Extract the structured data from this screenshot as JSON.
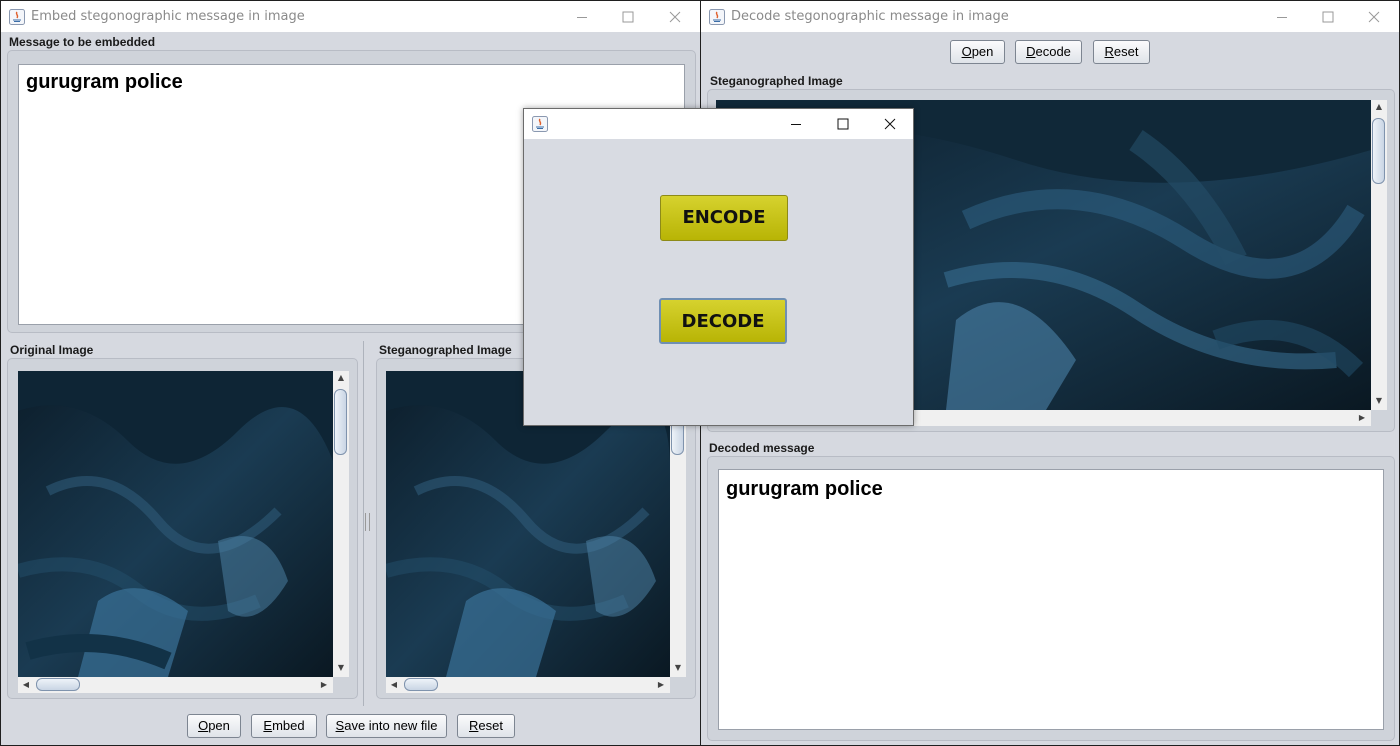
{
  "embed_window": {
    "title": "Embed stegonographic message in image",
    "message_label": "Message to be embedded",
    "message_text": "gurugram police",
    "original_label": "Original Image",
    "stego_label": "Steganographed Image",
    "buttons": {
      "open_first": "O",
      "open_rest": "pen",
      "embed_first": "E",
      "embed_rest": "mbed",
      "save_first": "S",
      "save_rest": "ave into new file",
      "reset_first": "R",
      "reset_rest": "eset"
    }
  },
  "decode_window": {
    "title": "Decode stegonographic message in image",
    "buttons": {
      "open_first": "O",
      "open_rest": "pen",
      "decode_first": "D",
      "decode_rest": "ecode",
      "reset_first": "R",
      "reset_rest": "eset"
    },
    "stego_label": "Steganographed Image",
    "decoded_label": "Decoded message",
    "decoded_text": "gurugram police"
  },
  "chooser_dialog": {
    "title": "",
    "encode_label": "ENCODE",
    "decode_label": "DECODE",
    "accent": "#c4c01a"
  },
  "icons": {
    "app": "java-icon",
    "minimize": "minimize-icon",
    "maximize": "maximize-icon",
    "close": "close-icon"
  }
}
